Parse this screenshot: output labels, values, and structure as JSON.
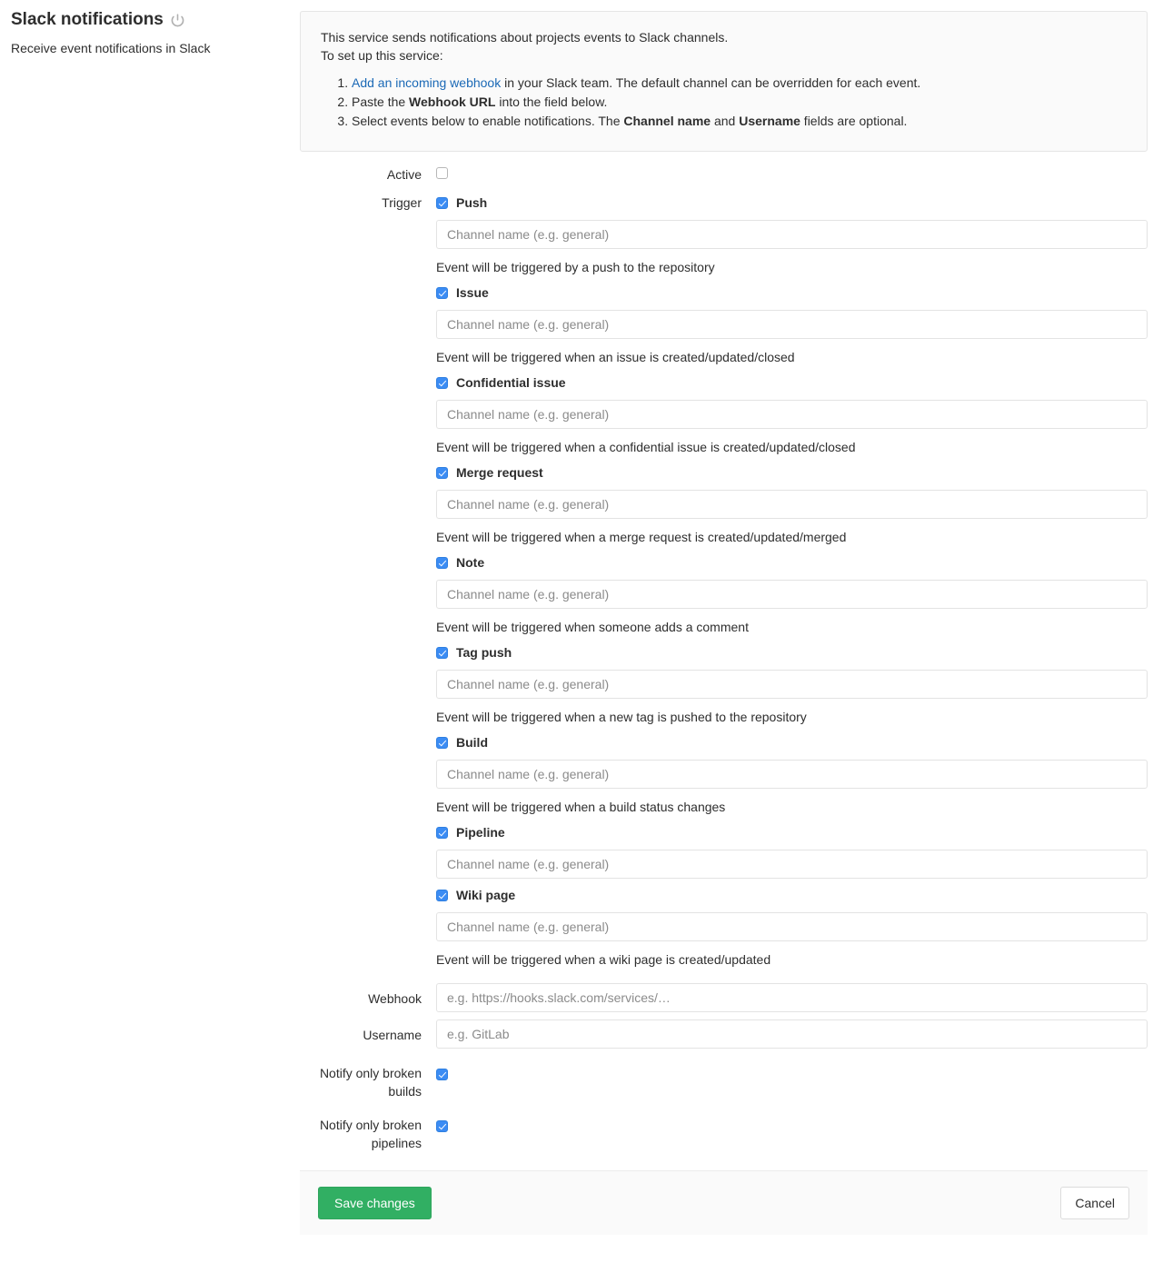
{
  "header": {
    "title": "Slack notifications",
    "power_icon": "power-icon",
    "subtitle": "Receive event notifications in Slack"
  },
  "info": {
    "line1": "This service sends notifications about projects events to Slack channels.",
    "line2": "To set up this service:",
    "steps": [
      {
        "link": "Add an incoming webhook",
        "after": " in your Slack team. The default channel can be overridden for each event."
      },
      {
        "pre": "Paste the ",
        "bold": "Webhook URL",
        "post": " into the field below."
      },
      {
        "pre": "Select events below to enable notifications. The ",
        "bold": "Channel name",
        "mid": " and ",
        "bold2": "Username",
        "post": " fields are optional."
      }
    ]
  },
  "form": {
    "active_label": "Active",
    "active_checked": false,
    "trigger_label": "Trigger",
    "channel_placeholder": "Channel name (e.g. general)",
    "triggers": [
      {
        "name": "Push",
        "checked": true,
        "desc": "Event will be triggered by a push to the repository"
      },
      {
        "name": "Issue",
        "checked": true,
        "desc": "Event will be triggered when an issue is created/updated/closed"
      },
      {
        "name": "Confidential issue",
        "checked": true,
        "desc": "Event will be triggered when a confidential issue is created/updated/closed"
      },
      {
        "name": "Merge request",
        "checked": true,
        "desc": "Event will be triggered when a merge request is created/updated/merged"
      },
      {
        "name": "Note",
        "checked": true,
        "desc": "Event will be triggered when someone adds a comment"
      },
      {
        "name": "Tag push",
        "checked": true,
        "desc": "Event will be triggered when a new tag is pushed to the repository"
      },
      {
        "name": "Build",
        "checked": true,
        "desc": "Event will be triggered when a build status changes"
      },
      {
        "name": "Pipeline",
        "checked": true,
        "desc": ""
      },
      {
        "name": "Wiki page",
        "checked": true,
        "desc": "Event will be triggered when a wiki page is created/updated"
      }
    ],
    "webhook_label": "Webhook",
    "webhook_placeholder": "e.g. https://hooks.slack.com/services/…",
    "webhook_value": "",
    "username_label": "Username",
    "username_placeholder": "e.g. GitLab",
    "username_value": "",
    "notify_broken_builds_label": "Notify only broken builds",
    "notify_broken_builds_checked": true,
    "notify_broken_pipelines_label": "Notify only broken pipelines",
    "notify_broken_pipelines_checked": true
  },
  "footer": {
    "save_label": "Save changes",
    "cancel_label": "Cancel"
  },
  "colors": {
    "link": "#1b69b6",
    "checkbox_accent": "#3b8cf4",
    "save_button": "#31af63",
    "panel_bg": "#fafafa",
    "border": "#e5e5e5"
  }
}
